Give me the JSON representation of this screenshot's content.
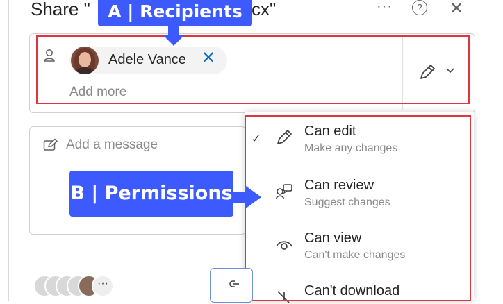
{
  "dialog": {
    "title_prefix": "Share \"",
    "title_suffix": "cx\"",
    "more_label": "···",
    "help_label": "?",
    "close_label": "✕"
  },
  "recipients": {
    "name": "Adele Vance",
    "remove_label": "✕",
    "add_more_placeholder": "Add more"
  },
  "message": {
    "placeholder": "Add a message"
  },
  "permissions": {
    "options": [
      {
        "title": "Can edit",
        "subtitle": "Make any changes",
        "selected": true,
        "icon": "pencil-icon"
      },
      {
        "title": "Can review",
        "subtitle": "Suggest changes",
        "selected": false,
        "icon": "review-icon"
      },
      {
        "title": "Can view",
        "subtitle": "Can't make changes",
        "selected": false,
        "icon": "eye-icon"
      },
      {
        "title": "Can't download",
        "subtitle": "",
        "selected": false,
        "icon": "no-download-icon"
      }
    ],
    "check_mark": "✓"
  },
  "annotations": {
    "a_label": "A | Recipients",
    "b_label": "B | Permissions",
    "highlight_color": "#e0343e",
    "callout_color": "#3d5afe"
  },
  "footer": {
    "more_people_label": "···"
  }
}
